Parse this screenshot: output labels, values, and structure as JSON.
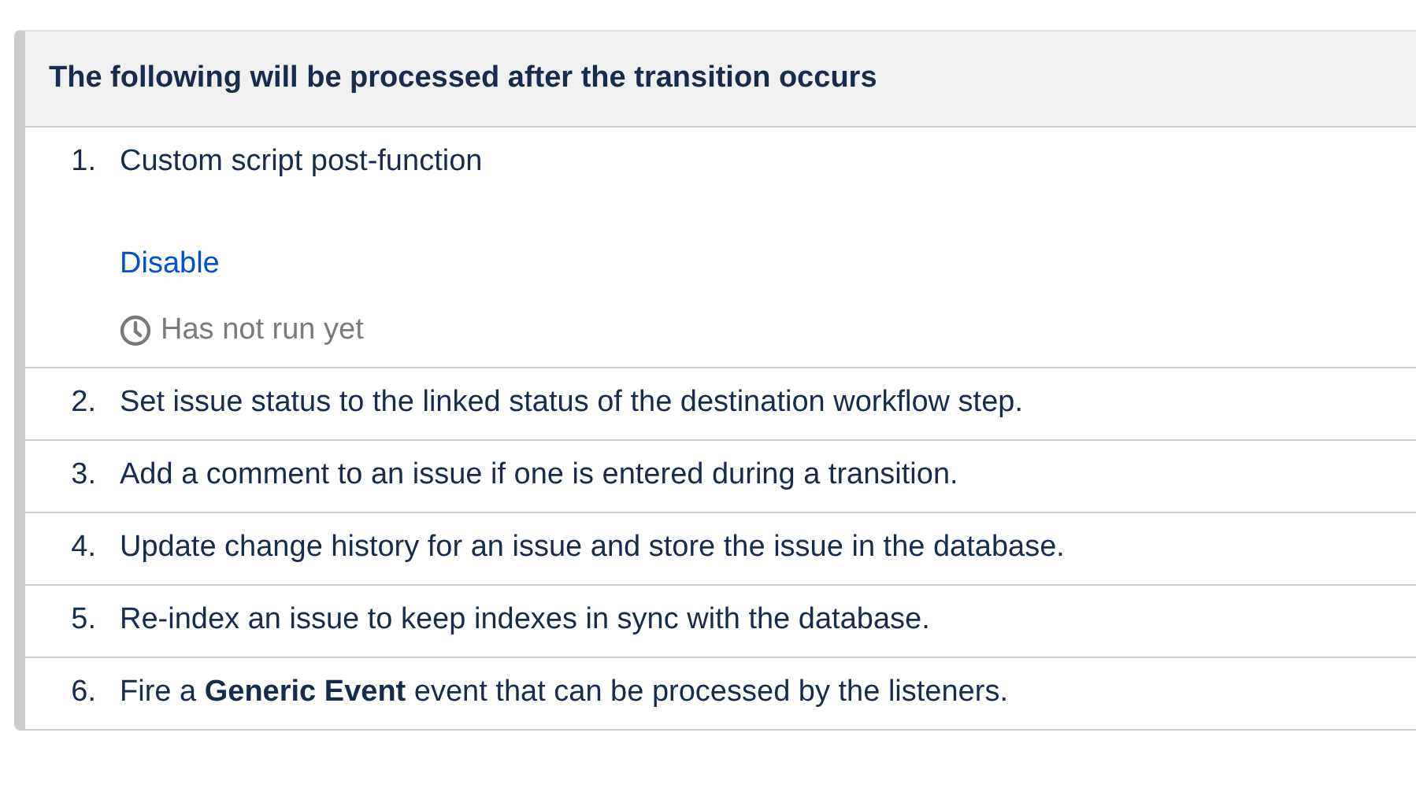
{
  "panel": {
    "title": "The following will be processed after the transition occurs",
    "items": [
      {
        "number": "1.",
        "text": "Custom script post-function",
        "link": "Disable",
        "status": "Has not run yet"
      },
      {
        "number": "2.",
        "text": "Set issue status to the linked status of the destination workflow step."
      },
      {
        "number": "3.",
        "text": "Add a comment to an issue if one is entered during a transition."
      },
      {
        "number": "4.",
        "text": "Update change history for an issue and store the issue in the database."
      },
      {
        "number": "5.",
        "text": "Re-index an issue to keep indexes in sync with the database."
      },
      {
        "number": "6.",
        "text": "Fire a **Generic Event** event that can be processed by the listeners."
      }
    ]
  }
}
